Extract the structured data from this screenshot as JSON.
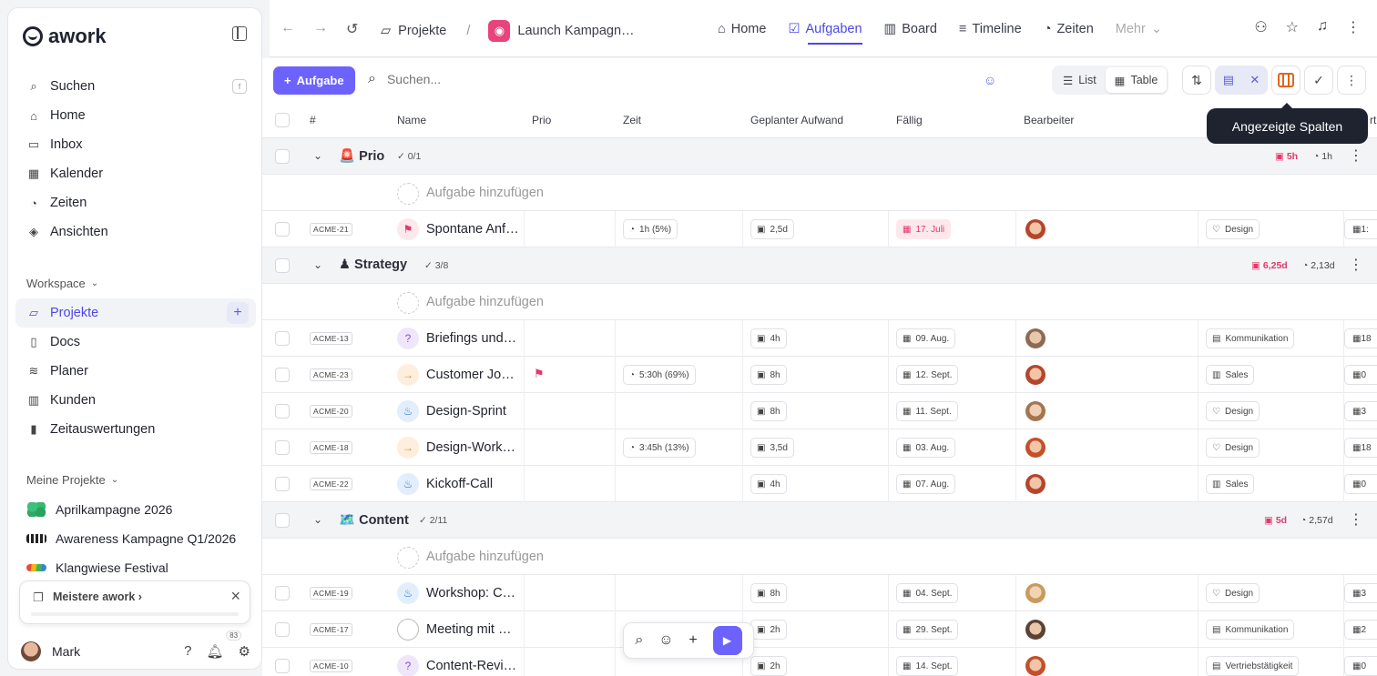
{
  "brand": {
    "name": "awork",
    "accent": "#6c63ff",
    "danger": "#e3386b"
  },
  "sidebar": {
    "search_label": "Suchen",
    "search_shortcut": "f",
    "items": [
      {
        "label": "Home",
        "icon": "home-icon"
      },
      {
        "label": "Inbox",
        "icon": "inbox-icon"
      },
      {
        "label": "Kalender",
        "icon": "calendar-icon"
      },
      {
        "label": "Zeiten",
        "icon": "timer-icon"
      },
      {
        "label": "Ansichten",
        "icon": "layers-icon"
      }
    ],
    "workspace_label": "Workspace",
    "workspace_items": [
      {
        "label": "Projekte",
        "icon": "folder-icon",
        "active": true
      },
      {
        "label": "Docs",
        "icon": "doc-icon"
      },
      {
        "label": "Planer",
        "icon": "planner-icon"
      },
      {
        "label": "Kunden",
        "icon": "building-icon"
      },
      {
        "label": "Zeitauswertungen",
        "icon": "chart-icon"
      }
    ],
    "my_projects_label": "Meine Projekte",
    "my_projects": [
      {
        "label": "Aprilkampagne 2026"
      },
      {
        "label": "Awareness Kampagne Q1/2026"
      },
      {
        "label": "Klangwiese Festival"
      }
    ],
    "promo_label": "Meistere awork",
    "user_name": "Mark",
    "notif_count": "83"
  },
  "topbar": {
    "breadcrumb_root": "Projekte",
    "breadcrumb_sep": "/",
    "project_name": "Launch Kampagn…",
    "tabs": [
      {
        "label": "Home",
        "icon": "home-icon"
      },
      {
        "label": "Aufgaben",
        "icon": "check-square-icon",
        "active": true
      },
      {
        "label": "Board",
        "icon": "board-icon"
      },
      {
        "label": "Timeline",
        "icon": "timeline-icon"
      },
      {
        "label": "Zeiten",
        "icon": "timer-icon"
      },
      {
        "label": "Mehr",
        "icon": "chevron-down-icon"
      }
    ]
  },
  "toolbar": {
    "add_label": "Aufgabe",
    "search_placeholder": "Suchen...",
    "view_list": "List",
    "view_table": "Table",
    "tooltip": "Angezeigte Spalten"
  },
  "table": {
    "headers": {
      "num": "#",
      "name": "Name",
      "prio": "Prio",
      "zeit": "Zeit",
      "aufwand": "Geplanter Aufwand",
      "faellig": "Fällig",
      "bearbeiter": "Bearbeiter",
      "cut": "rt"
    },
    "add_task_label": "Aufgabe hinzufügen",
    "groups": [
      {
        "emoji": "🚨",
        "title": "Prio",
        "count": "0/1",
        "planned": "5h",
        "tracked": "1h"
      },
      {
        "emoji": "♟",
        "title": "Strategy",
        "count": "3/8",
        "planned": "6,25d",
        "tracked": "2,13d"
      },
      {
        "emoji": "🗺️",
        "title": "Content",
        "count": "2/11",
        "planned": "5d",
        "tracked": "2,57d"
      }
    ],
    "tasks": [
      {
        "key": "ACME-21",
        "name": "Spontane Anf…",
        "zeit": "1h (5%)",
        "aufwand": "2,5d",
        "due": "17. Juli",
        "tag": "Design",
        "cut": "1:"
      },
      {
        "key": "ACME-13",
        "name": "Briefings und …",
        "zeit": "",
        "aufwand": "4h",
        "due": "09. Aug.",
        "tag": "Kommunikation",
        "cut": "18"
      },
      {
        "key": "ACME-23",
        "name": "Customer Jou…",
        "zeit": "5:30h (69%)",
        "aufwand": "8h",
        "due": "12. Sept.",
        "tag": "Sales",
        "cut": "0"
      },
      {
        "key": "ACME-20",
        "name": "Design-Sprint",
        "zeit": "",
        "aufwand": "8h",
        "due": "11. Sept.",
        "tag": "Design",
        "cut": "3"
      },
      {
        "key": "ACME-18",
        "name": "Design-Works…",
        "zeit": "3:45h (13%)",
        "aufwand": "3,5d",
        "due": "03. Aug.",
        "tag": "Design",
        "cut": "18"
      },
      {
        "key": "ACME-22",
        "name": "Kickoff-Call",
        "zeit": "",
        "aufwand": "4h",
        "due": "07. Aug.",
        "tag": "Sales",
        "cut": "0"
      },
      {
        "key": "ACME-19",
        "name": "Workshop: Co…",
        "zeit": "",
        "aufwand": "8h",
        "due": "04. Sept.",
        "tag": "Design",
        "cut": "3"
      },
      {
        "key": "ACME-17",
        "name": "Meeting mit K…",
        "zeit": "",
        "aufwand": "2h",
        "due": "29. Sept.",
        "tag": "Kommunikation",
        "cut": "2"
      },
      {
        "key": "ACME-10",
        "name": "Content-Revi…",
        "zeit": "",
        "aufwand": "2h",
        "due": "14. Sept.",
        "tag": "Vertriebstätigkeit",
        "cut": "0"
      }
    ]
  }
}
